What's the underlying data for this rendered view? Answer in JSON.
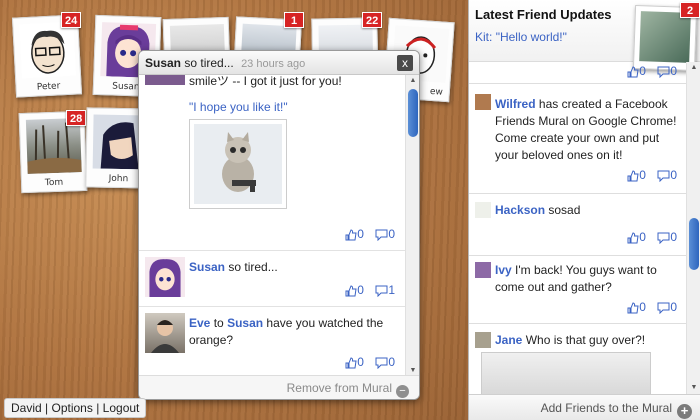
{
  "board": {
    "polaroids": [
      {
        "name": "Peter",
        "badge": "24"
      },
      {
        "name": "Susan",
        "badge": ""
      },
      {
        "name": "",
        "badge": ""
      },
      {
        "name": "",
        "badge": "1"
      },
      {
        "name": "",
        "badge": "22"
      },
      {
        "name": "ew",
        "badge": ""
      },
      {
        "name": "Tom",
        "badge": "28"
      },
      {
        "name": "John",
        "badge": ""
      }
    ]
  },
  "popup": {
    "header_name": "Susan",
    "header_status": "so tired...",
    "header_time": "23 hours ago",
    "close_label": "x",
    "post1": {
      "text": "smileツ -- I got it just for you!",
      "quote": "\"I hope you like it!\"",
      "likes": "0",
      "comments": "0"
    },
    "post2": {
      "author": "Susan",
      "text": "so tired...",
      "likes": "0",
      "comments": "1"
    },
    "post3": {
      "author": "Eve",
      "connector": "to",
      "target": "Susan",
      "text": "have you watched the orange?",
      "likes": "0",
      "comments": "0"
    },
    "footer_label": "Remove from Mural"
  },
  "sidebar": {
    "title": "Latest Friend Updates",
    "latest_name": "Kit:",
    "latest_text": "\"Hello world!\"",
    "badge": "2",
    "top_likes": "0",
    "top_comments": "0",
    "items": [
      {
        "name": "Wilfred",
        "text": "has created a Facebook Friends Mural on Google Chrome! Come create your own and put your beloved ones on it!",
        "likes": "0",
        "comments": "0"
      },
      {
        "name": "Hackson",
        "text": "sosad",
        "likes": "0",
        "comments": "0"
      },
      {
        "name": "Ivy",
        "text": "I'm back! You guys want to come out and gather?",
        "likes": "0",
        "comments": "0"
      },
      {
        "name": "Jane",
        "text": "Who is that guy over?!",
        "likes": "",
        "comments": ""
      }
    ],
    "footer_label": "Add Friends to the Mural"
  },
  "user_nav": {
    "user": "David",
    "sep1": "|",
    "options": "Options",
    "sep2": "|",
    "logout": "Logout"
  }
}
